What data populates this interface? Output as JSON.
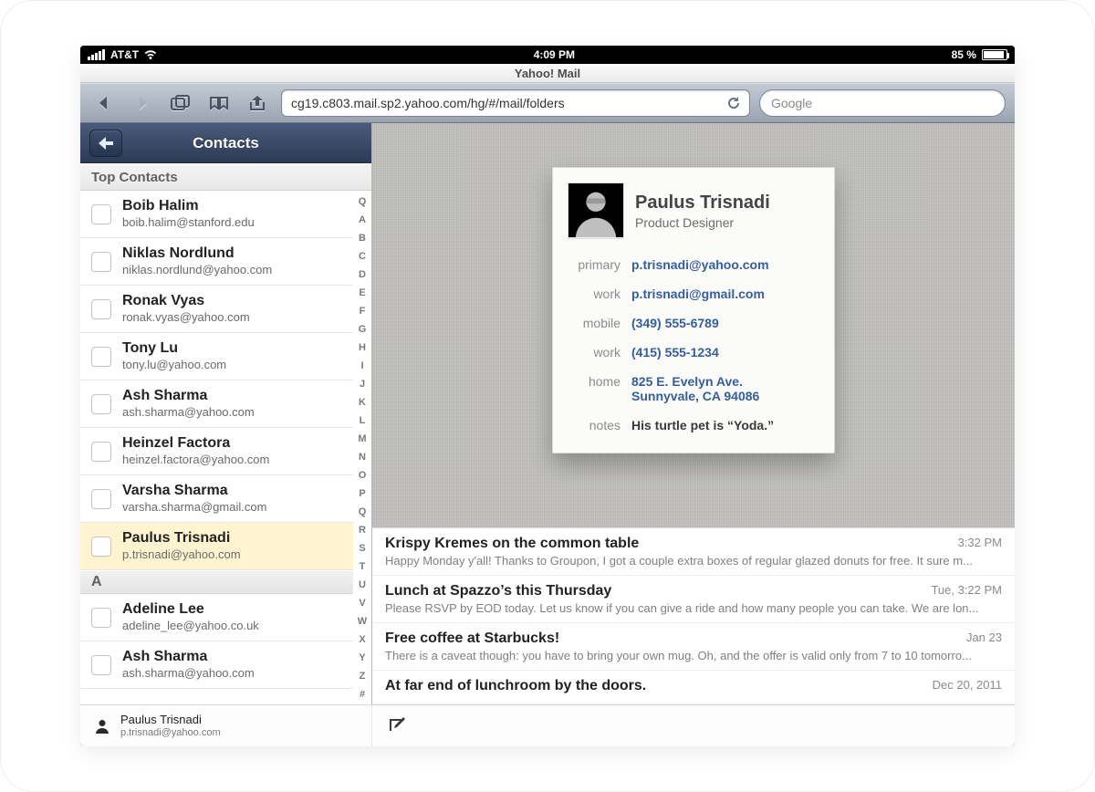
{
  "status": {
    "carrier": "AT&T",
    "time": "4:09 PM",
    "battery_pct": "85 %"
  },
  "page_title": "Yahoo! Mail",
  "browser": {
    "url": "cg19.c803.mail.sp2.yahoo.com/hg/#/mail/folders",
    "search_placeholder": "Google"
  },
  "sidebar": {
    "nav_title": "Contacts",
    "top_section": "Top Contacts",
    "letter_section": "A",
    "index": [
      "Q",
      "A",
      "B",
      "C",
      "D",
      "E",
      "F",
      "G",
      "H",
      "I",
      "J",
      "K",
      "L",
      "M",
      "N",
      "O",
      "P",
      "Q",
      "R",
      "S",
      "T",
      "U",
      "V",
      "W",
      "X",
      "Y",
      "Z",
      "#"
    ],
    "top_contacts": [
      {
        "name": "Boib Halim",
        "email": "boib.halim@stanford.edu",
        "selected": false
      },
      {
        "name": "Niklas Nordlund",
        "email": "niklas.nordlund@yahoo.com",
        "selected": false
      },
      {
        "name": "Ronak Vyas",
        "email": "ronak.vyas@yahoo.com",
        "selected": false
      },
      {
        "name": "Tony Lu",
        "email": "tony.lu@yahoo.com",
        "selected": false
      },
      {
        "name": "Ash Sharma",
        "email": "ash.sharma@yahoo.com",
        "selected": false
      },
      {
        "name": "Heinzel Factora",
        "email": "heinzel.factora@yahoo.com",
        "selected": false
      },
      {
        "name": "Varsha Sharma",
        "email": "varsha.sharma@gmail.com",
        "selected": false
      },
      {
        "name": "Paulus Trisnadi",
        "email": "p.trisnadi@yahoo.com",
        "selected": true
      }
    ],
    "a_contacts": [
      {
        "name": "Adeline Lee",
        "email": "adeline_lee@yahoo.co.uk"
      },
      {
        "name": "Ash Sharma",
        "email": "ash.sharma@yahoo.com"
      }
    ]
  },
  "card": {
    "name": "Paulus Trisnadi",
    "role": "Product Designer",
    "labels": {
      "primary": "primary",
      "work_email": "work",
      "mobile": "mobile",
      "work_phone": "work",
      "home": "home",
      "notes": "notes"
    },
    "primary_email": "p.trisnadi@yahoo.com",
    "work_email": "p.trisnadi@gmail.com",
    "mobile": "(349) 555-6789",
    "work_phone": "(415) 555-1234",
    "home_line1": "825 E. Evelyn Ave.",
    "home_line2": "Sunnyvale, CA 94086",
    "notes": "His turtle pet is “Yoda.”"
  },
  "emails": [
    {
      "subject": "Krispy Kremes on the common table",
      "time": "3:32 PM",
      "preview": "Happy Monday y'all! Thanks to Groupon, I got a couple extra boxes of regular glazed donuts for free. It sure m..."
    },
    {
      "subject": "Lunch at Spazzo’s this Thursday",
      "time": "Tue, 3:22 PM",
      "preview": "Please RSVP by EOD today. Let us know if you can give a ride and how many people you can take. We are lon..."
    },
    {
      "subject": "Free coffee at Starbucks!",
      "time": "Jan 23",
      "preview": "There is a caveat though: you have to bring your own mug. Oh, and the offer is valid only from 7 to 10 tomorro..."
    },
    {
      "subject": "At far end of lunchroom by the doors.",
      "time": "Dec 20, 2011",
      "preview": ""
    }
  ],
  "bottom": {
    "name": "Paulus Trisnadi",
    "email": "p.trisnadi@yahoo.com"
  }
}
